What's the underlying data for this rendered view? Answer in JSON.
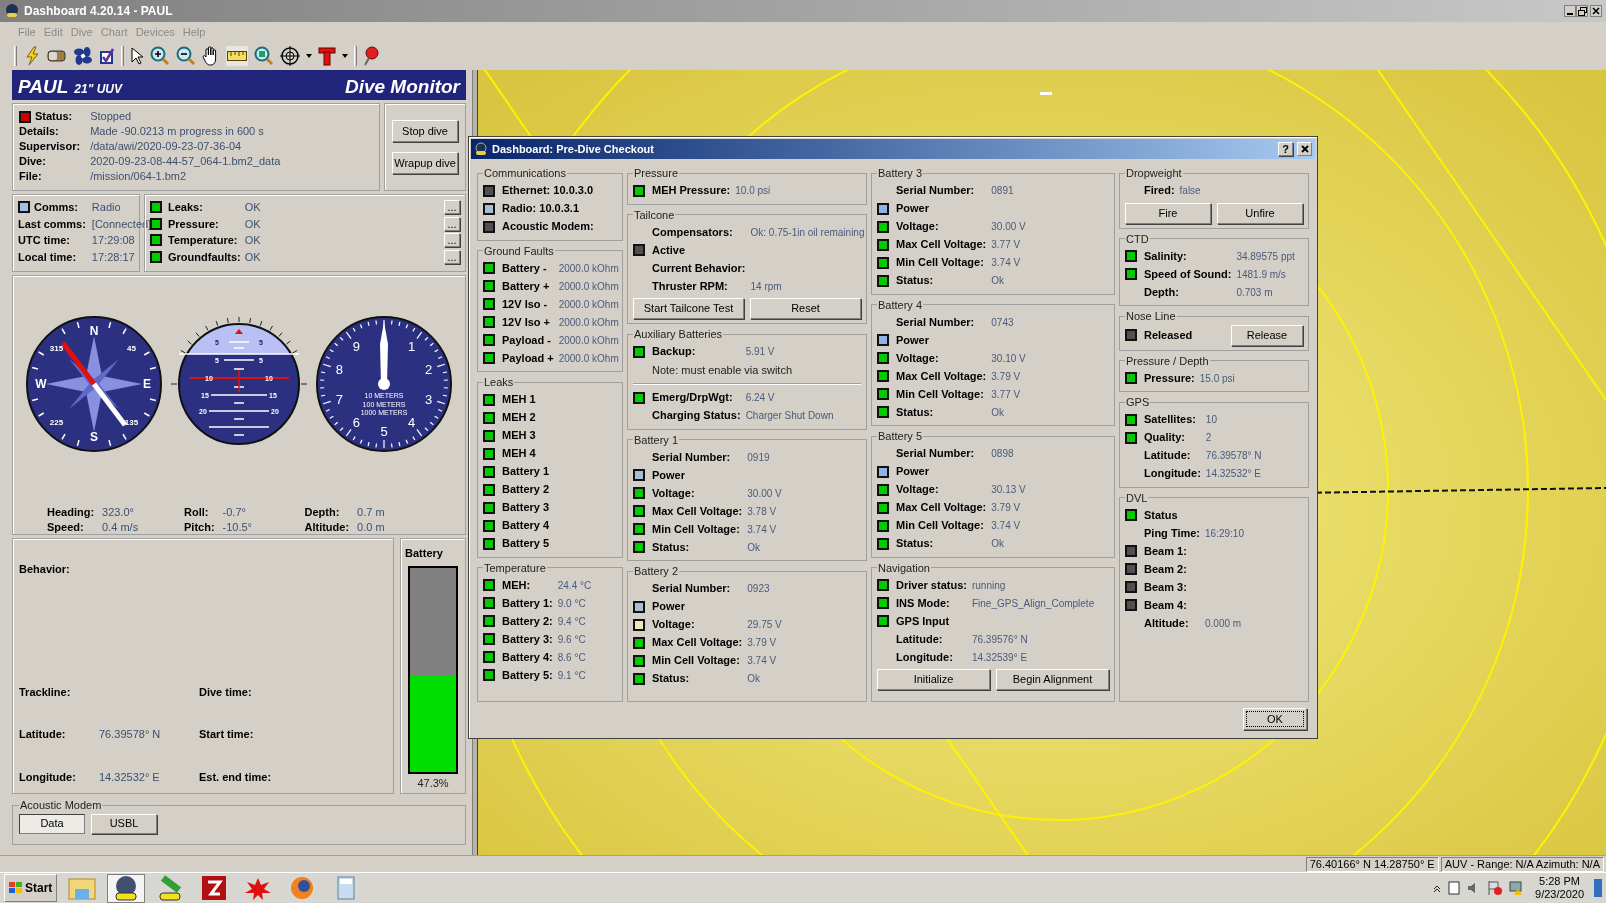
{
  "window": {
    "title": "Dashboard 4.20.14 - PAUL"
  },
  "menu": [
    "File",
    "Edit",
    "Dive",
    "Chart",
    "Devices",
    "Help"
  ],
  "vehicle": {
    "name": "PAUL",
    "type": "21\" UUV",
    "title": "Dive Monitor"
  },
  "status_box": {
    "rows": [
      {
        "label": "Status:",
        "value": "Stopped",
        "color": "#cc0000"
      },
      {
        "label": "Details:",
        "value": "Made -90.0213 m progress in 600 s"
      },
      {
        "label": "Supervisor:",
        "value": "/data/awi/2020-09-23-07-36-04"
      },
      {
        "label": "Dive:",
        "value": "2020-09-23-08-44-57_064-1.bm2_data"
      },
      {
        "label": "File:",
        "value": "/mission/064-1.bm2"
      }
    ],
    "buttons": [
      "Stop dive",
      "Wrapup dive"
    ]
  },
  "comms": {
    "rows": [
      {
        "label": "Comms:",
        "value": "Radio",
        "color": "#a0c0e8"
      },
      {
        "label": "Last comms:",
        "value": "[Connected]"
      },
      {
        "label": "UTC time:",
        "value": "17:29:08"
      },
      {
        "label": "Local time:",
        "value": "17:28:17"
      }
    ]
  },
  "health": {
    "rows": [
      {
        "label": "Leaks:",
        "value": "OK",
        "color": "#00cc00",
        "button": "..."
      },
      {
        "label": "Pressure:",
        "value": "OK",
        "color": "#00cc00",
        "button": "..."
      },
      {
        "label": "Temperature:",
        "value": "OK",
        "color": "#00cc00",
        "button": "..."
      },
      {
        "label": "Groundfaults:",
        "value": "OK",
        "color": "#00cc00",
        "button": "..."
      }
    ]
  },
  "gauges": {
    "compass_labels": [
      "N",
      "45",
      "E",
      "135",
      "S",
      "225",
      "W",
      "315"
    ],
    "attitude_labels": [
      "5",
      "5",
      "5",
      "5",
      "10",
      "10",
      "15",
      "15",
      "20",
      "20"
    ],
    "depth_digits": [
      "1",
      "2",
      "3",
      "4",
      "5",
      "6",
      "7",
      "8",
      "9"
    ],
    "depth_units": [
      "10 METERS",
      "100 METERS",
      "1000 METERS"
    ]
  },
  "readings": [
    {
      "label": "Heading:",
      "value": "323.0°"
    },
    {
      "label": "Speed:",
      "value": "0.4 m/s"
    },
    {
      "label": "Roll:",
      "value": "-0.7°"
    },
    {
      "label": "Pitch:",
      "value": "-10.5°"
    },
    {
      "label": "Depth:",
      "value": "0.7 m"
    },
    {
      "label": "Altitude:",
      "value": "0.0 m"
    }
  ],
  "dive_info": {
    "behavior": "Behavior:",
    "fields": [
      {
        "label": "Trackline:"
      },
      {
        "label": "Dive time:"
      },
      {
        "label": "Latitude:",
        "value": "76.39578° N"
      },
      {
        "label": "Start time:"
      },
      {
        "label": "Longitude:",
        "value": "14.32532° E"
      },
      {
        "label": "Est. end time:"
      }
    ]
  },
  "battery": {
    "title": "Battery",
    "level": 0.473,
    "reading": "47.3%"
  },
  "acoustic_modem": {
    "title": "Acoustic Modem",
    "tabs": [
      {
        "label": "Data",
        "selected": true
      },
      {
        "label": "USBL",
        "selected": false
      }
    ]
  },
  "status_bar": [
    "76.40166° N 14.28750° E",
    "AUV - Range: N/A  Azimuth: N/A"
  ],
  "taskbar": {
    "start": "Start",
    "time": "5:28 PM",
    "date": "9/23/2020"
  },
  "dialog": {
    "title": "Dashboard: Pre-Dive Checkout",
    "help": "?",
    "ok": "OK",
    "columns": [
      {
        "groups": [
          {
            "title": "Communications",
            "rows": [
              {
                "label": "Ethernet: 10.0.3.0",
                "color": "#505050"
              },
              {
                "label": "Radio: 10.0.3.1",
                "color": "#a8bcd4"
              },
              {
                "label": "Acoustic Modem:",
                "color": "#505050"
              }
            ]
          },
          {
            "title": "Ground Faults",
            "rows": [
              {
                "label": "Battery -",
                "value": "2000.0 kOhm",
                "color": "#00cc00"
              },
              {
                "label": "Battery +",
                "value": "2000.0 kOhm",
                "color": "#00cc00"
              },
              {
                "label": "12V Iso -",
                "value": "2000.0 kOhm",
                "color": "#00cc00"
              },
              {
                "label": "12V Iso +",
                "value": "2000.0 kOhm",
                "color": "#00cc00"
              },
              {
                "label": "Payload -",
                "value": "2000.0 kOhm",
                "color": "#00cc00"
              },
              {
                "label": "Payload +",
                "value": "2000.0 kOhm",
                "color": "#00cc00"
              }
            ]
          },
          {
            "title": "Leaks",
            "rows": [
              {
                "label": "MEH 1",
                "color": "#00cc00"
              },
              {
                "label": "MEH 2",
                "color": "#00cc00"
              },
              {
                "label": "MEH 3",
                "color": "#00cc00"
              },
              {
                "label": "MEH 4",
                "color": "#00cc00"
              },
              {
                "label": "Battery 1",
                "color": "#00cc00"
              },
              {
                "label": "Battery 2",
                "color": "#00cc00"
              },
              {
                "label": "Battery 3",
                "color": "#00cc00"
              },
              {
                "label": "Battery 4",
                "color": "#00cc00"
              },
              {
                "label": "Battery 5",
                "color": "#00cc00"
              }
            ]
          },
          {
            "title": "Temperature",
            "rows": [
              {
                "label": "MEH:",
                "value": "24.4 °C",
                "color": "#00cc00"
              },
              {
                "label": "Battery 1:",
                "value": "9.0 °C",
                "color": "#00cc00"
              },
              {
                "label": "Battery 2:",
                "value": "9.4 °C",
                "color": "#00cc00"
              },
              {
                "label": "Battery 3:",
                "value": "9.6 °C",
                "color": "#00cc00"
              },
              {
                "label": "Battery 4:",
                "value": "8.6 °C",
                "color": "#00cc00"
              },
              {
                "label": "Battery 5:",
                "value": "9.1 °C",
                "color": "#00cc00"
              }
            ]
          }
        ]
      },
      {
        "groups": [
          {
            "title": "Pressure",
            "rows": [
              {
                "label": "MEH Pressure:",
                "value": "10.0 psi",
                "color": "#00cc00"
              }
            ]
          },
          {
            "title": "Tailcone",
            "rows": [
              {
                "label": "Compensators:",
                "value": "Ok:  0.75-1in oil remaining"
              },
              {
                "label": "Active",
                "color": "#505050"
              },
              {
                "label": "Current Behavior:"
              },
              {
                "label": "Thruster RPM:",
                "value": "14 rpm"
              }
            ],
            "buttons": [
              "Start Tailcone Test",
              "Reset"
            ]
          },
          {
            "title": "Auxiliary Batteries",
            "rows": [
              {
                "label": "Backup:",
                "value": "5.91 V",
                "color": "#00cc00"
              },
              {
                "kind": "note",
                "label": "Note: must enable via switch"
              },
              {
                "kind": "rule"
              },
              {
                "label": "Emerg/DrpWgt:",
                "value": "6.24 V",
                "color": "#00cc00"
              },
              {
                "label": "Charging Status:",
                "value": "Charger Shut Down"
              }
            ]
          },
          {
            "title": "Battery 1",
            "rows": [
              {
                "label": "Serial Number:",
                "value": "0919"
              },
              {
                "label": "Power",
                "color": "#a8bcd4"
              },
              {
                "label": "Voltage:",
                "value": "30.00 V",
                "color": "#00cc00"
              },
              {
                "label": "Max Cell Voltage:",
                "value": "3.78 V",
                "color": "#00cc00"
              },
              {
                "label": "Min Cell Voltage:",
                "value": "3.74 V",
                "color": "#00cc00"
              },
              {
                "label": "Status:",
                "value": "Ok",
                "color": "#00cc00"
              }
            ]
          },
          {
            "title": "Battery 2",
            "rows": [
              {
                "label": "Serial Number:",
                "value": "0923"
              },
              {
                "label": "Power",
                "color": "#a8bcd4"
              },
              {
                "label": "Voltage:",
                "value": "29.75 V",
                "color": "#ece8b8"
              },
              {
                "label": "Max Cell Voltage:",
                "value": "3.79 V",
                "color": "#00cc00"
              },
              {
                "label": "Min Cell Voltage:",
                "value": "3.74 V",
                "color": "#00cc00"
              },
              {
                "label": "Status:",
                "value": "Ok",
                "color": "#00cc00"
              }
            ]
          }
        ]
      },
      {
        "groups": [
          {
            "title": "Battery 3",
            "rows": [
              {
                "label": "Serial Number:",
                "value": "0891"
              },
              {
                "label": "Power",
                "color": "#8cb4e6"
              },
              {
                "label": "Voltage:",
                "value": "30.00 V",
                "color": "#00cc00"
              },
              {
                "label": "Max Cell Voltage:",
                "value": "3.77 V",
                "color": "#00cc00"
              },
              {
                "label": "Min Cell Voltage:",
                "value": "3.74 V",
                "color": "#00cc00"
              },
              {
                "label": "Status:",
                "value": "Ok",
                "color": "#00cc00"
              }
            ]
          },
          {
            "title": "Battery 4",
            "rows": [
              {
                "label": "Serial Number:",
                "value": "0743"
              },
              {
                "label": "Power",
                "color": "#8cb4e6"
              },
              {
                "label": "Voltage:",
                "value": "30.10 V",
                "color": "#00cc00"
              },
              {
                "label": "Max Cell Voltage:",
                "value": "3.79 V",
                "color": "#00cc00"
              },
              {
                "label": "Min Cell Voltage:",
                "value": "3.77 V",
                "color": "#00cc00"
              },
              {
                "label": "Status:",
                "value": "Ok",
                "color": "#00cc00"
              }
            ]
          },
          {
            "title": "Battery 5",
            "rows": [
              {
                "label": "Serial Number:",
                "value": "0898"
              },
              {
                "label": "Power",
                "color": "#8cb4e6"
              },
              {
                "label": "Voltage:",
                "value": "30.13 V",
                "color": "#00cc00"
              },
              {
                "label": "Max Cell Voltage:",
                "value": "3.79 V",
                "color": "#00cc00"
              },
              {
                "label": "Min Cell Voltage:",
                "value": "3.74 V",
                "color": "#00cc00"
              },
              {
                "label": "Status:",
                "value": "Ok",
                "color": "#00cc00"
              }
            ]
          },
          {
            "title": "Navigation",
            "rows": [
              {
                "label": "Driver status:",
                "value": "running",
                "color": "#00cc00"
              },
              {
                "label": "INS Mode:",
                "value": "Fine_GPS_Align_Complete",
                "color": "#00cc00"
              },
              {
                "label": "GPS Input",
                "color": "#00cc00"
              },
              {
                "label": "Latitude:",
                "value": "76.39576° N"
              },
              {
                "label": "Longitude:",
                "value": "14.32539° E"
              }
            ],
            "buttons": [
              "Initialize",
              "Begin Alignment"
            ]
          }
        ]
      },
      {
        "groups": [
          {
            "title": "Dropweight",
            "rows": [
              {
                "label": "Fired:",
                "value": "false"
              }
            ],
            "buttons": [
              "Fire",
              "Unfire"
            ]
          },
          {
            "title": "CTD",
            "rows": [
              {
                "label": "Salinity:",
                "value": "34.89575 ppt",
                "color": "#00cc00"
              },
              {
                "label": "Speed of Sound:",
                "value": "1481.9 m/s",
                "color": "#00cc00"
              },
              {
                "label": "Depth:",
                "value": "0.703 m"
              }
            ]
          },
          {
            "title": "Nose Line",
            "rows": [
              {
                "label": "Released",
                "color": "#505050",
                "button": "Release"
              }
            ]
          },
          {
            "title": "Pressure / Depth",
            "rows": [
              {
                "label": "Pressure:",
                "value": "15.0 psi",
                "color": "#00cc00"
              }
            ]
          },
          {
            "title": "GPS",
            "rows": [
              {
                "label": "Satellites:",
                "value": "10",
                "color": "#00cc00"
              },
              {
                "label": "Quality:",
                "value": "2",
                "color": "#00cc00"
              },
              {
                "label": "Latitude:",
                "value": "76.39578° N"
              },
              {
                "label": "Longitude:",
                "value": "14.32532° E"
              }
            ]
          },
          {
            "title": "DVL",
            "rows": [
              {
                "label": "Status",
                "color": "#00cc00"
              },
              {
                "label": "Ping Time:",
                "value": "16:29:10"
              },
              {
                "label": "Beam 1:",
                "color": "#505050"
              },
              {
                "label": "Beam 2:",
                "color": "#505050"
              },
              {
                "label": "Beam 3:",
                "color": "#505050"
              },
              {
                "label": "Beam 4:",
                "color": "#505050"
              },
              {
                "label": "Altitude:",
                "value": "0.000 m"
              }
            ]
          }
        ]
      }
    ]
  }
}
